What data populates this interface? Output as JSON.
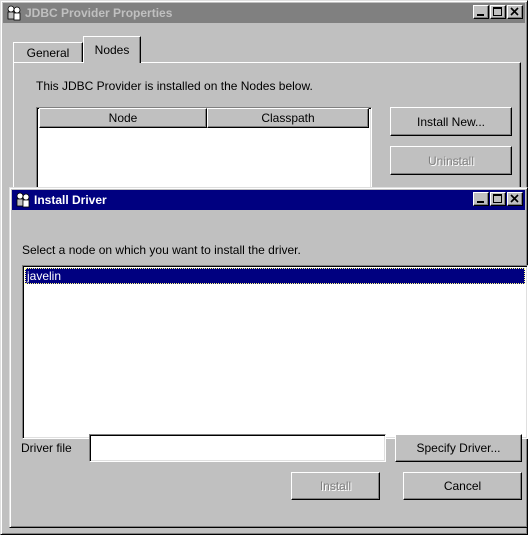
{
  "back_window": {
    "title": "JDBC Provider Properties",
    "tabs": [
      {
        "label": "General"
      },
      {
        "label": "Nodes"
      }
    ],
    "description": "This JDBC Provider is installed on the Nodes below.",
    "table": {
      "columns": [
        "Node",
        "Classpath"
      ]
    },
    "install_new_label": "Install New...",
    "uninstall_label": "Uninstall",
    "uninstall_enabled": false
  },
  "dialog": {
    "title": "Install Driver",
    "instruction": "Select a node on which you want to install the driver.",
    "nodes": [
      {
        "label": "javelin",
        "selected": true
      }
    ],
    "driver_file_label": "Driver file",
    "driver_file_value": "",
    "specify_driver_label": "Specify Driver...",
    "install_label": "Install",
    "install_enabled": false,
    "cancel_label": "Cancel"
  },
  "icons": {
    "window_icon": "people-icon",
    "minimize": "minimize-icon",
    "maximize": "maximize-icon",
    "close": "close-icon"
  },
  "colors": {
    "active_title": "#000080",
    "inactive_title": "#808080",
    "face": "#c0c0c0",
    "selection": "#000080"
  }
}
